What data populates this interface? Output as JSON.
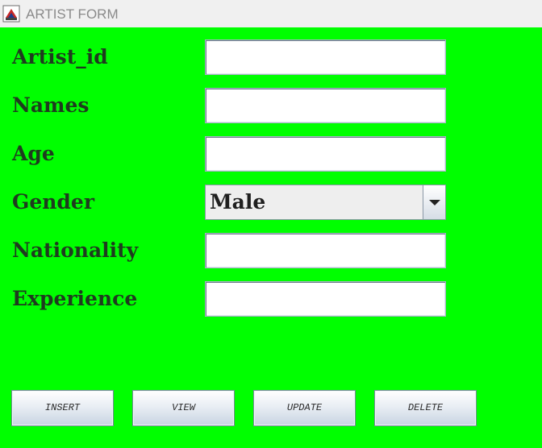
{
  "window": {
    "title": "ARTIST FORM",
    "icon": "app-java-icon"
  },
  "form": {
    "fields": [
      {
        "label": "Artist_id",
        "value": ""
      },
      {
        "label": "Names",
        "value": ""
      },
      {
        "label": "Age",
        "value": ""
      },
      {
        "label": "Gender",
        "value": "Male"
      },
      {
        "label": "Nationality",
        "value": ""
      },
      {
        "label": "Experience",
        "value": ""
      }
    ]
  },
  "buttons": {
    "insert": "INSERT",
    "view": "VIEW",
    "update": "UPDATE",
    "delete": "DELETE"
  },
  "colors": {
    "background": "#00ff00",
    "label_text": "#1f3b1f",
    "titlebar": "#f0f0f0"
  }
}
